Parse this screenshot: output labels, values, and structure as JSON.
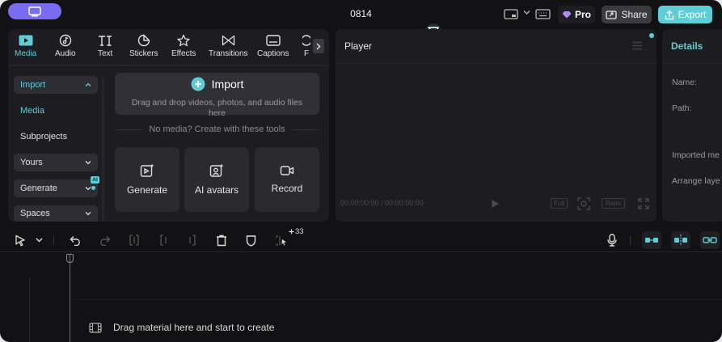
{
  "project": {
    "title": "0814"
  },
  "header": {
    "pro_label": "Pro",
    "share_label": "Share",
    "export_label": "Export"
  },
  "media_tabs": [
    {
      "label": "Media",
      "icon": "media-icon",
      "active": true
    },
    {
      "label": "Audio",
      "icon": "audio-icon"
    },
    {
      "label": "Text",
      "icon": "text-icon"
    },
    {
      "label": "Stickers",
      "icon": "stickers-icon"
    },
    {
      "label": "Effects",
      "icon": "effects-icon"
    },
    {
      "label": "Transitions",
      "icon": "transitions-icon"
    },
    {
      "label": "Captions",
      "icon": "captions-icon"
    },
    {
      "label": "F",
      "icon": "filters-icon"
    }
  ],
  "sidebar": {
    "import": "Import",
    "media": "Media",
    "subprojects": "Subprojects",
    "yours": "Yours",
    "generate": "Generate",
    "ai_badge": "AI",
    "spaces": "Spaces"
  },
  "import_box": {
    "title": "Import",
    "subtitle": "Drag and drop videos, photos, and audio files here"
  },
  "no_media_text": "No media? Create with these tools",
  "tools": [
    {
      "label": "Generate",
      "icon": "generate-icon"
    },
    {
      "label": "AI avatars",
      "icon": "ai-avatar-icon"
    },
    {
      "label": "Record",
      "icon": "record-icon"
    }
  ],
  "player": {
    "title": "Player",
    "time": "00:00:00:00 / 00:00:00:00",
    "full_label": "Full",
    "ratio_label": "Ratio"
  },
  "details": {
    "title": "Details",
    "name_label": "Name:",
    "path_label": "Path:",
    "imported_label": "Imported me",
    "arrange_label": "Arrange laye"
  },
  "timeline": {
    "selection_count": "33",
    "drop_hint": "Drag material here and start to create"
  },
  "colors": {
    "accent": "#5fcdd6",
    "brand_purple": "#7a6cf0",
    "background": "#121214",
    "panel": "#1d1d21"
  }
}
